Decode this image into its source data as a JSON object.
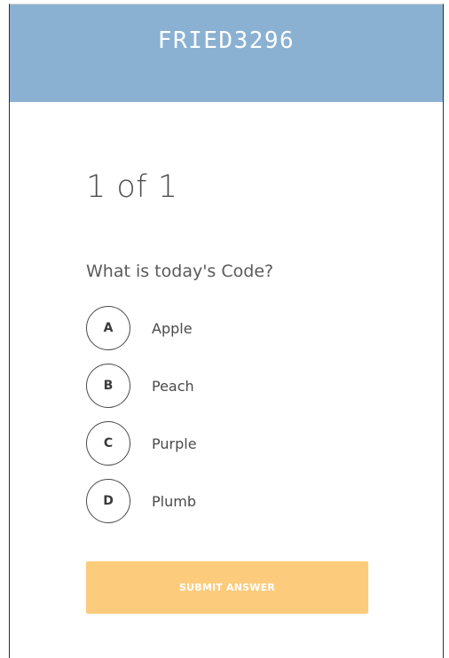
{
  "header": {
    "title": "FRIED3296",
    "background_color": "#8ab1d2"
  },
  "quiz": {
    "counter": "1 of 1",
    "question": "What is today's Code?",
    "options": [
      {
        "letter": "A",
        "label": "Apple"
      },
      {
        "letter": "B",
        "label": "Peach"
      },
      {
        "letter": "C",
        "label": "Purple"
      },
      {
        "letter": "D",
        "label": "Plumb"
      }
    ],
    "submit_label": "SUBMIT ANSWER",
    "submit_color": "#fccc7c"
  }
}
